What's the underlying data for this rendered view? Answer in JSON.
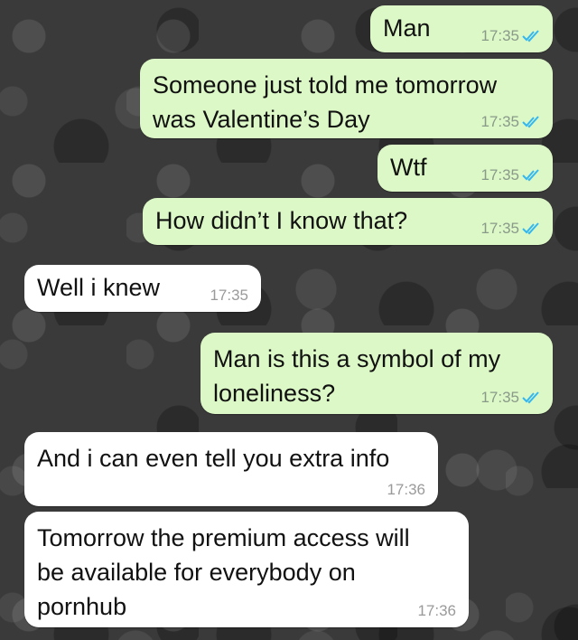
{
  "colors": {
    "outgoing_bubble": "#dcf8c6",
    "incoming_bubble": "#ffffff",
    "read_tick": "#34b7f1",
    "background": "#3a3a3a"
  },
  "messages": [
    {
      "direction": "outgoing",
      "text": "Man",
      "time": "17:35",
      "status_icon": "double-check-read-icon"
    },
    {
      "direction": "outgoing",
      "text": "Someone just told me tomorrow\nwas Valentine’s Day",
      "time": "17:35",
      "status_icon": "double-check-read-icon"
    },
    {
      "direction": "outgoing",
      "text": "Wtf",
      "time": "17:35",
      "status_icon": "double-check-read-icon"
    },
    {
      "direction": "outgoing",
      "text": "How didn’t I know that?",
      "time": "17:35",
      "status_icon": "double-check-read-icon"
    },
    {
      "direction": "incoming",
      "text": "Well i knew",
      "time": "17:35"
    },
    {
      "direction": "outgoing",
      "text": "Man is this a symbol of my\nloneliness?",
      "time": "17:35",
      "status_icon": "double-check-read-icon"
    },
    {
      "direction": "incoming",
      "text": "And i can even tell you extra info",
      "time": "17:36"
    },
    {
      "direction": "incoming",
      "text": "Tomorrow the premium access will\nbe available for everybody on\npornhub",
      "time": "17:36"
    }
  ]
}
